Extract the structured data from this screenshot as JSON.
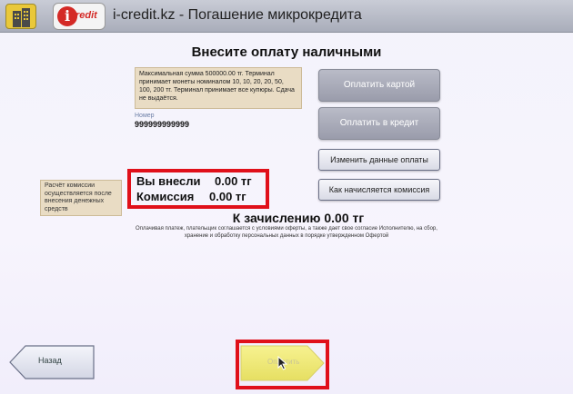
{
  "header": {
    "title": "i-credit.kz - Погашение микрокредита",
    "logo_mark": "i",
    "logo_text": "redit",
    "home_icon": "building-icon"
  },
  "main": {
    "heading": "Внесите оплату наличными",
    "info_text": "Максимальная сумма 500000.00 тг. Терминал принимает монеты номиналом 10, 10, 20, 20, 50, 100, 200 тг. Терминал принимает все купюры. Сдача не выдаётся.",
    "number_label": "Номер",
    "number_value": "999999999999",
    "commission_note": "Расчёт комиссии осуществляется после внесения денежных средств",
    "paid_label": "Вы внесли",
    "paid_value": "0.00 тг",
    "commission_label": "Комиссия",
    "commission_value": "0.00 тг",
    "total_label": "К зачислению",
    "total_value": "0.00 тг",
    "offer_text": "Оплачивая платеж, плательщик соглашается с условиями оферты, а также дает свое согласие Исполнителю, на сбор, хранение и обработку персональных данных в порядке утвержденном Офертой"
  },
  "actions": {
    "pay_card": "Оплатить картой",
    "pay_credit": "Оплатить в кредит",
    "change_data": "Изменить данные оплаты",
    "how_commission": "Как начисляется комиссия",
    "back": "Назад",
    "pay": "Оплатить"
  },
  "colors": {
    "highlight": "#e0101a",
    "accent_logo": "#d42a26",
    "pay_button": "#f1ec7a"
  }
}
